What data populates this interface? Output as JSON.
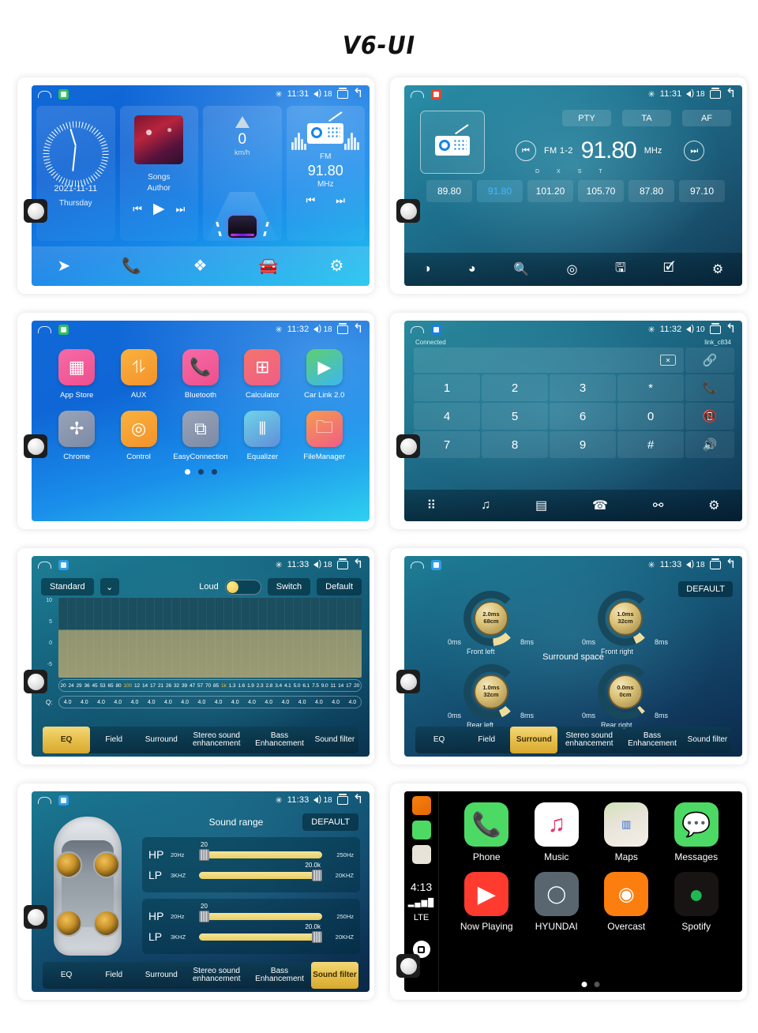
{
  "page": {
    "title": "V6-UI"
  },
  "screens": {
    "home": {
      "status": {
        "time": "11:31",
        "volume": "18",
        "bt_icon": "bluetooth-icon"
      },
      "clock": {
        "date": "2021-11-11",
        "weekday": "Thursday"
      },
      "music": {
        "title": "Songs",
        "author": "Author"
      },
      "speed": {
        "value": "0",
        "unit": "km/h"
      },
      "radio": {
        "band": "FM",
        "freq": "91.80",
        "unit": "MHz"
      },
      "dock": [
        "navigation-icon",
        "phone-icon",
        "apps-icon",
        "carplay-icon",
        "settings-icon"
      ]
    },
    "radio": {
      "status": {
        "time": "11:31",
        "volume": "18"
      },
      "chips": [
        "PTY",
        "TA",
        "AF"
      ],
      "band": "FM 1-2",
      "freq": "91.80",
      "unit": "MHz",
      "dx": "DX",
      "st": "ST",
      "presets": [
        "89.80",
        "91.80",
        "101.20",
        "105.70",
        "87.80",
        "97.10"
      ],
      "active_preset_index": 1,
      "toolbar": [
        "band-icon",
        "stereo-icon",
        "search-icon",
        "scan-icon",
        "save-icon",
        "edit-icon",
        "settings-icon"
      ]
    },
    "apps": {
      "status": {
        "time": "11:32",
        "volume": "18"
      },
      "items": [
        {
          "label": "App Store",
          "icon": "grid-icon",
          "color1": "#f56ba6",
          "color2": "#ef4f8e"
        },
        {
          "label": "AUX",
          "icon": "sliders-icon",
          "color1": "#f9b23c",
          "color2": "#f4922b"
        },
        {
          "label": "Bluetooth",
          "icon": "phone-icon",
          "color1": "#f56ba6",
          "color2": "#ee4f8d"
        },
        {
          "label": "Calculator",
          "icon": "calculator-icon",
          "color1": "#f4756c",
          "color2": "#ef5d86"
        },
        {
          "label": "Car Link 2.0",
          "icon": "play-circle-icon",
          "color1": "#5fcf6e",
          "color2": "#3bb7f0"
        },
        {
          "label": "Chrome",
          "icon": "compass-icon",
          "color1": "#9aa4b8",
          "color2": "#7c8aa6"
        },
        {
          "label": "Control",
          "icon": "steering-wheel-icon",
          "color1": "#f9b23c",
          "color2": "#f4922b"
        },
        {
          "label": "EasyConnection",
          "icon": "screen-mirror-icon",
          "color1": "#9aa4b8",
          "color2": "#7c8aa6"
        },
        {
          "label": "Equalizer",
          "icon": "faders-icon",
          "color1": "#6fd3e8",
          "color2": "#5f8fd8"
        },
        {
          "label": "FileManager",
          "icon": "folder-icon",
          "color1": "#f79b4e",
          "color2": "#ef5d86"
        }
      ],
      "page_dots": 3,
      "active_dot": 0
    },
    "dialer": {
      "status": {
        "time": "11:32",
        "volume": "10"
      },
      "connection_status": "Connected",
      "device_name": "link_c834",
      "input_value": "",
      "keys": [
        "1",
        "2",
        "3",
        "*",
        "4",
        "5",
        "6",
        "0",
        "7",
        "8",
        "9",
        "#"
      ],
      "actions": [
        "link-icon",
        "call-icon",
        "hangup-icon",
        "speaker-icon"
      ],
      "toolbar": [
        "dialpad-icon",
        "music-icon",
        "contacts-icon",
        "call-log-icon",
        "disconnect-icon",
        "settings-icon"
      ]
    },
    "equalizer": {
      "status": {
        "time": "11:33",
        "volume": "18"
      },
      "preset": "Standard",
      "loud_label": "Loud",
      "loud_on": true,
      "switch_label": "Switch",
      "default_label": "Default",
      "y_axis": [
        "10",
        "5",
        "0",
        "-5"
      ],
      "frequencies": [
        "20",
        "24",
        "29",
        "36",
        "45",
        "53",
        "65",
        "80",
        "100",
        "12",
        "14",
        "17",
        "21",
        "26",
        "32",
        "39",
        "47",
        "57",
        "70",
        "85",
        "1k",
        "1.3",
        "1.6",
        "1.9",
        "2.3",
        "2.8",
        "3.4",
        "4.1",
        "5.0",
        "6.1",
        "7.5",
        "9.0",
        "11",
        "14",
        "17",
        "20"
      ],
      "highlight_freqs": [
        "100",
        "1k"
      ],
      "q_label": "Q:",
      "q_values": [
        "4.0",
        "4.0",
        "4.0",
        "4.0",
        "4.0",
        "4.0",
        "4.0",
        "4.0",
        "4.0",
        "4.0",
        "4.0",
        "4.0",
        "4.0",
        "4.0",
        "4.0",
        "4.0",
        "4.0",
        "4.0"
      ],
      "tabs": [
        "EQ",
        "Field",
        "Surround",
        "Stereo sound enhancement",
        "Bass Enhancement",
        "Sound filter"
      ],
      "active_tab": 0
    },
    "surround": {
      "status": {
        "time": "11:33",
        "volume": "18"
      },
      "default_label": "DEFAULT",
      "section_title": "Surround space",
      "knobs": [
        {
          "name": "Front left",
          "delay": "2.0ms",
          "distance": "68cm",
          "min": "0ms",
          "max": "8ms"
        },
        {
          "name": "Front right",
          "delay": "1.0ms",
          "distance": "32cm",
          "min": "0ms",
          "max": "8ms"
        },
        {
          "name": "Rear left",
          "delay": "1.0ms",
          "distance": "32cm",
          "min": "0ms",
          "max": "8ms"
        },
        {
          "name": "Rear right",
          "delay": "0.0ms",
          "distance": "0cm",
          "min": "0ms",
          "max": "8ms"
        }
      ],
      "tabs": [
        "EQ",
        "Field",
        "Surround",
        "Stereo sound enhancement",
        "Bass Enhancement",
        "Sound filter"
      ],
      "active_tab": 2
    },
    "sound_filter": {
      "status": {
        "time": "11:33",
        "volume": "18"
      },
      "title": "Sound range",
      "default_label": "DEFAULT",
      "panels": [
        {
          "rows": [
            {
              "type": "HP",
              "min": "20Hz",
              "max": "250Hz",
              "value": "20",
              "fill_pct": 100,
              "thumb_pct": 0
            },
            {
              "type": "LP",
              "min": "3KHZ",
              "max": "20KHZ",
              "value": "20.0k",
              "fill_pct": 100,
              "thumb_pct": 100
            }
          ]
        },
        {
          "rows": [
            {
              "type": "HP",
              "min": "20Hz",
              "max": "250Hz",
              "value": "20",
              "fill_pct": 100,
              "thumb_pct": 0
            },
            {
              "type": "LP",
              "min": "3KHZ",
              "max": "20KHZ",
              "value": "20.0k",
              "fill_pct": 100,
              "thumb_pct": 100
            }
          ]
        }
      ],
      "tabs": [
        "EQ",
        "Field",
        "Surround",
        "Stereo sound enhancement",
        "Bass Enhancement",
        "Sound filter"
      ],
      "active_tab": 5
    },
    "carplay": {
      "time": "4:13",
      "network": "LTE",
      "signal": "signal-bars-icon",
      "rail_icons": [
        "overcast-icon",
        "messages-icon",
        "maps-icon"
      ],
      "home_icon": "carplay-home-icon",
      "apps": [
        {
          "label": "Phone",
          "icon": "phone-icon",
          "color": "#4cd964"
        },
        {
          "label": "Music",
          "icon": "music-note-icon",
          "color": "#ffffff"
        },
        {
          "label": "Maps",
          "icon": "maps-icon",
          "color": "#e8e3d8"
        },
        {
          "label": "Messages",
          "icon": "message-bubble-icon",
          "color": "#4cd964"
        },
        {
          "label": "Now Playing",
          "icon": "play-icon",
          "color": "#ff3b30"
        },
        {
          "label": "HYUNDAI",
          "icon": "hyundai-logo-icon",
          "color": "#596670"
        },
        {
          "label": "Overcast",
          "icon": "overcast-icon",
          "color": "#fc7e0f"
        },
        {
          "label": "Spotify",
          "icon": "spotify-icon",
          "color": "#191414"
        }
      ],
      "page_dots": 2,
      "active_dot": 0
    }
  }
}
